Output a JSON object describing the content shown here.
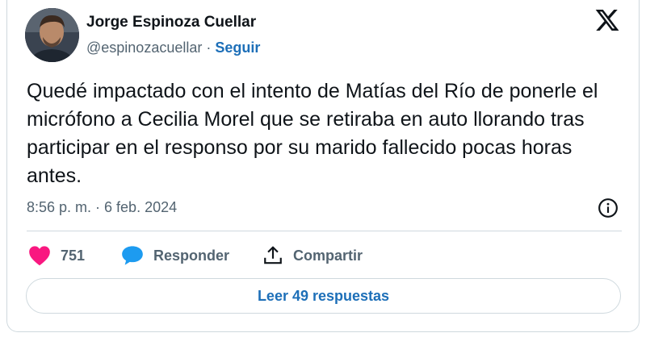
{
  "author": {
    "name": "Jorge Espinoza Cuellar",
    "handle": "@espinozacuellar",
    "separator": "·",
    "follow_label": "Seguir"
  },
  "tweet": {
    "text": "Quedé impactado con el intento de Matías del Río de ponerle el micrófono a Cecilia Morel que se retiraba en auto llorando tras participar en el responso por su marido fallecido pocas horas antes.",
    "timestamp": "8:56 p. m. · 6 feb. 2024"
  },
  "actions": {
    "like_count": "751",
    "reply_label": "Responder",
    "share_label": "Compartir"
  },
  "read_replies_label": "Leer 49 respuestas",
  "icons": {
    "platform": "x-logo-icon",
    "info": "info-icon",
    "like": "heart-icon",
    "reply": "speech-bubble-icon",
    "share": "share-upload-icon"
  },
  "colors": {
    "text": "#0f1419",
    "secondary": "#536471",
    "link": "#1d6fb8",
    "like": "#f91880",
    "reply": "#1d9bf0",
    "border": "#cfd9de"
  }
}
